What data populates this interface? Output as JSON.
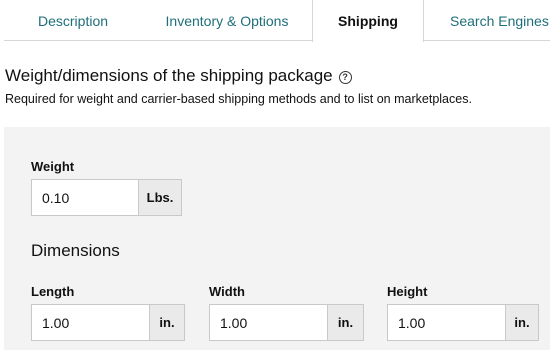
{
  "tabs": [
    {
      "label": "Description",
      "active": false
    },
    {
      "label": "Inventory & Options",
      "active": false
    },
    {
      "label": "Shipping",
      "active": true
    },
    {
      "label": "Search Engines",
      "active": false
    }
  ],
  "section": {
    "title": "Weight/dimensions of the shipping package",
    "help_icon": "?",
    "description": "Required for weight and carrier-based shipping methods and to list on marketplaces."
  },
  "weight": {
    "label": "Weight",
    "value": "0.10",
    "unit": "Lbs."
  },
  "dimensions": {
    "title": "Dimensions",
    "length": {
      "label": "Length",
      "value": "1.00",
      "unit": "in."
    },
    "width": {
      "label": "Width",
      "value": "1.00",
      "unit": "in."
    },
    "height": {
      "label": "Height",
      "value": "1.00",
      "unit": "in."
    }
  },
  "colors": {
    "tab_link": "#1f6f7a",
    "panel_bg": "#f3f3f3",
    "unit_bg": "#eaeaea",
    "border": "#c9c9c9"
  }
}
